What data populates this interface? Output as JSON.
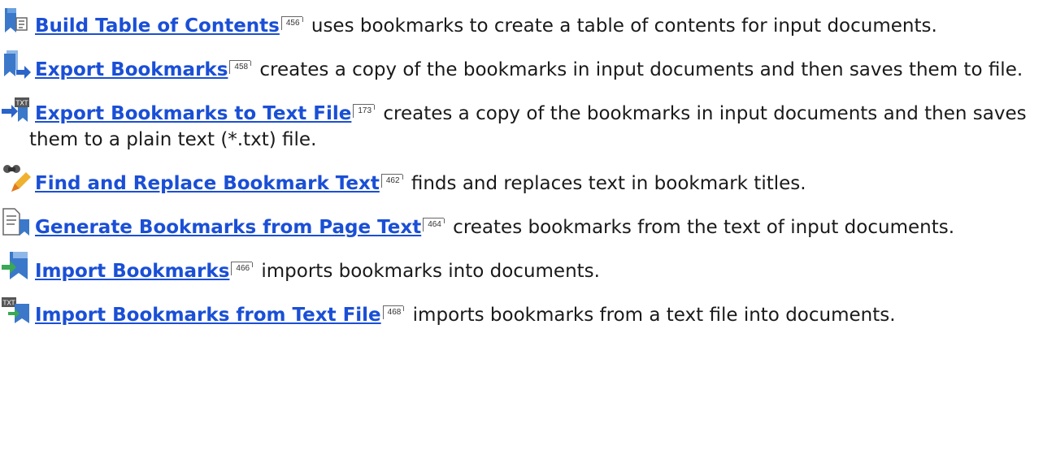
{
  "entries": [
    {
      "icon": "bookmark-toc-icon",
      "link": "Build Table of Contents",
      "page": "456",
      "text": " uses bookmarks to create a table of contents for input documents."
    },
    {
      "icon": "export-bookmarks-icon",
      "link": "Export Bookmarks",
      "page": "458",
      "text": " creates a copy of the bookmarks in input documents and then saves them to file."
    },
    {
      "icon": "export-text-file-icon",
      "link": "Export Bookmarks to Text File",
      "page": "173",
      "text": " creates a copy of the bookmarks in input documents and then saves them to a plain text (*.txt) file."
    },
    {
      "icon": "find-replace-icon",
      "link": "Find and Replace Bookmark Text",
      "page": "462",
      "text": " finds and replaces text in bookmark titles."
    },
    {
      "icon": "generate-bookmarks-icon",
      "link": "Generate Bookmarks from Page Text",
      "page": "464",
      "text": " creates bookmarks from the text of input documents."
    },
    {
      "icon": "import-bookmarks-icon",
      "link": "Import Bookmarks",
      "page": "466",
      "text": " imports bookmarks into documents."
    },
    {
      "icon": "import-text-file-icon",
      "link": "Import Bookmarks from Text File",
      "page": "468",
      "text": " imports bookmarks from a text file into documents."
    }
  ]
}
